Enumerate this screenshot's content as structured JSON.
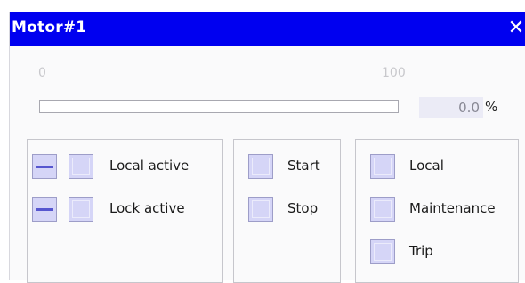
{
  "window": {
    "title": "Motor#1",
    "close_glyph": "✕",
    "close_icon": "close-icon"
  },
  "speed": {
    "scale_min": "0",
    "scale_max": "100",
    "value": "0.0",
    "unit": "%",
    "fill_percent": 0
  },
  "status_panel": {
    "rows": [
      {
        "label": "Local active"
      },
      {
        "label": "Lock active"
      }
    ]
  },
  "command_panel": {
    "rows": [
      {
        "label": "Start"
      },
      {
        "label": "Stop"
      }
    ]
  },
  "mode_panel": {
    "rows": [
      {
        "label": "Local"
      },
      {
        "label": "Maintenance"
      },
      {
        "label": "Trip"
      }
    ]
  },
  "colors": {
    "titlebar": "#0000f0",
    "indicator": "#d5d5f7",
    "indicator_border": "#9d9dc8",
    "dash": "#5656cf"
  }
}
